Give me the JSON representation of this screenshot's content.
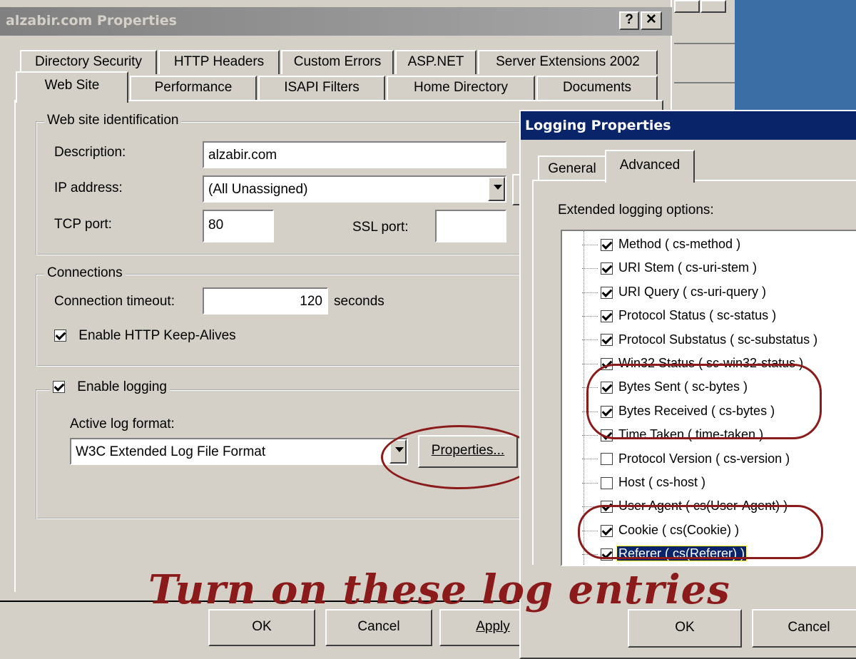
{
  "main_dialog": {
    "title": "alzabir.com Properties",
    "help_btn": "?",
    "close_btn": "✕",
    "tabs_row1": [
      "Directory Security",
      "HTTP Headers",
      "Custom Errors",
      "ASP.NET",
      "Server Extensions 2002"
    ],
    "tabs_row2": [
      "Web Site",
      "Performance",
      "ISAPI Filters",
      "Home Directory",
      "Documents"
    ],
    "identification": {
      "legend": "Web site identification",
      "description_label": "Description:",
      "description_value": "alzabir.com",
      "ip_label": "IP address:",
      "ip_value": "(All Unassigned)",
      "tcp_label": "TCP port:",
      "tcp_value": "80",
      "ssl_label": "SSL port:",
      "ssl_value": ""
    },
    "connections": {
      "legend": "Connections",
      "timeout_label": "Connection timeout:",
      "timeout_value": "120",
      "timeout_unit": "seconds",
      "keepalive_label": "Enable HTTP Keep-Alives",
      "keepalive_checked": true
    },
    "logging": {
      "enable_label": "Enable logging",
      "enable_checked": true,
      "format_label": "Active log format:",
      "format_value": "W3C Extended Log File Format",
      "properties_btn": "Properties..."
    },
    "buttons": {
      "ok": "OK",
      "cancel": "Cancel",
      "apply": "Apply"
    }
  },
  "logging_dialog": {
    "title": "Logging Properties",
    "tabs": [
      "General",
      "Advanced"
    ],
    "options_label": "Extended logging options:",
    "items": [
      {
        "label": "Method ( cs-method )",
        "checked": true
      },
      {
        "label": "URI Stem ( cs-uri-stem )",
        "checked": true
      },
      {
        "label": "URI Query ( cs-uri-query )",
        "checked": true
      },
      {
        "label": "Protocol Status ( sc-status )",
        "checked": true
      },
      {
        "label": "Protocol Substatus ( sc-substatus )",
        "checked": true
      },
      {
        "label": "Win32 Status ( sc-win32-status )",
        "checked": true
      },
      {
        "label": "Bytes Sent ( sc-bytes )",
        "checked": true
      },
      {
        "label": "Bytes Received ( cs-bytes )",
        "checked": true
      },
      {
        "label": "Time Taken ( time-taken )",
        "checked": true
      },
      {
        "label": "Protocol Version ( cs-version )",
        "checked": false
      },
      {
        "label": "Host ( cs-host )",
        "checked": false
      },
      {
        "label": "User Agent ( cs(User-Agent) )",
        "checked": true
      },
      {
        "label": "Cookie ( cs(Cookie) )",
        "checked": true
      },
      {
        "label": "Referer ( cs(Referer) )",
        "checked": true,
        "selected": true
      }
    ],
    "buttons": {
      "ok": "OK",
      "cancel": "Cancel"
    }
  },
  "annotation": {
    "text": "Turn on these log entries",
    "color": "#8b1a1a"
  },
  "colors": {
    "active_title": "#0a246a",
    "inactive_title": "#808080",
    "desktop_blue": "#3a6ea5"
  }
}
